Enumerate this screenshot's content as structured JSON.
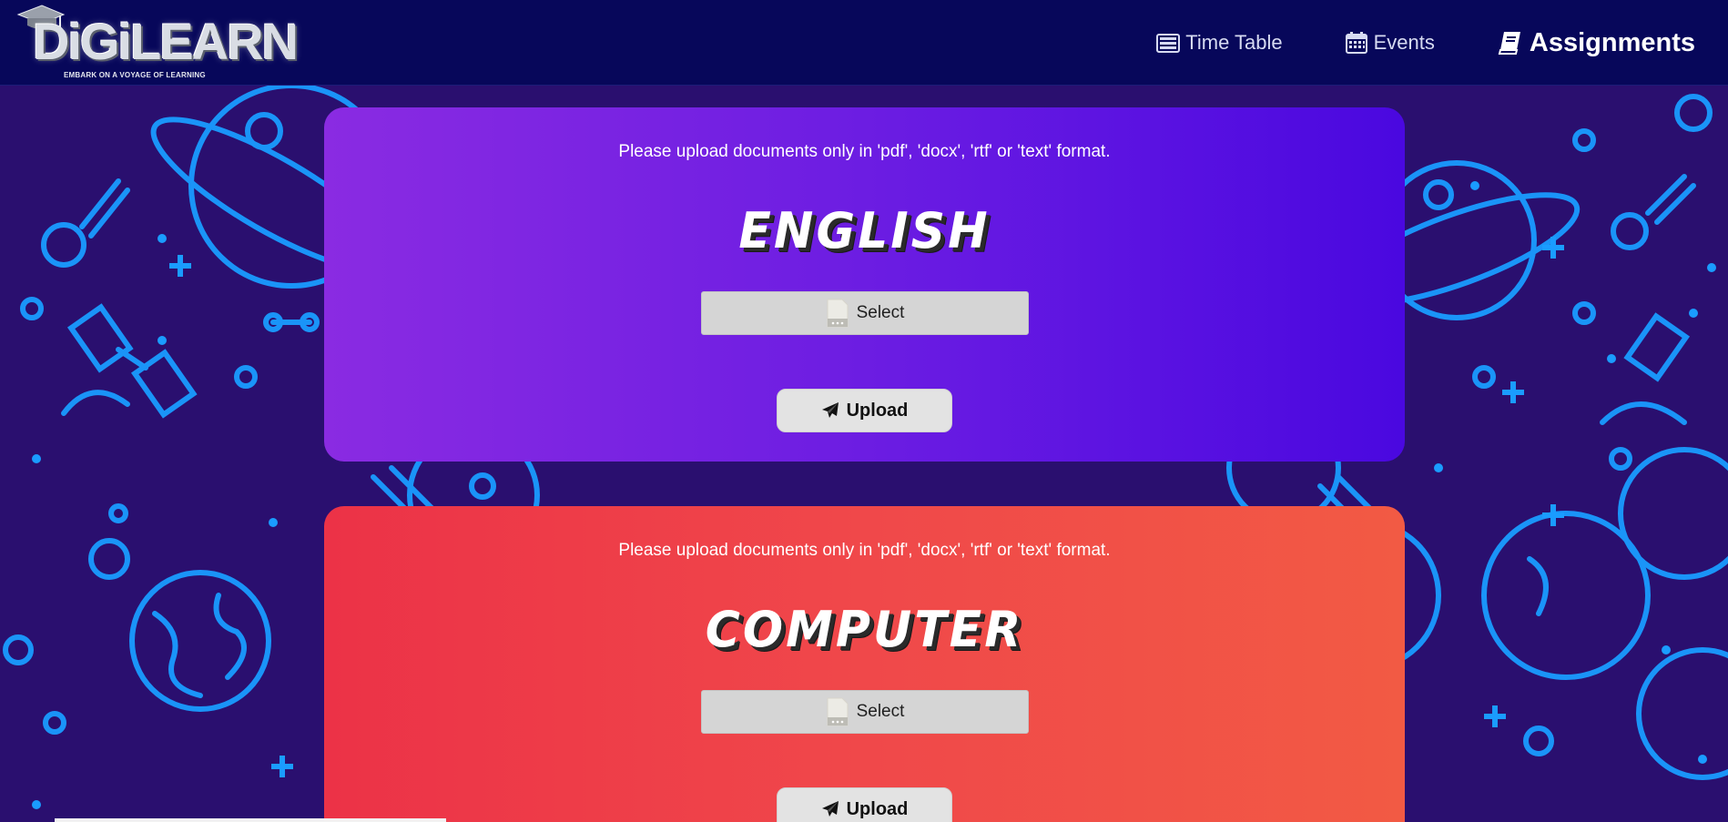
{
  "app": {
    "logo_text": "DiGiLEARN",
    "logo_tagline": "EMBARK ON A VOYAGE OF LEARNING"
  },
  "nav": {
    "items": [
      {
        "label": "Time Table",
        "icon": "timetable-icon",
        "active": false
      },
      {
        "label": "Events",
        "icon": "calendar-icon",
        "active": false
      },
      {
        "label": "Assignments",
        "icon": "book-icon",
        "active": true
      }
    ]
  },
  "cards": [
    {
      "subject": "ENGLISH",
      "note": "Please upload documents only in 'pdf', 'docx', 'rtf' or 'text' format.",
      "select_label": "Select",
      "upload_label": "Upload",
      "gradient": [
        "#8a2be2",
        "#4a08e0"
      ]
    },
    {
      "subject": "COMPUTER",
      "note": "Please upload documents only in 'pdf', 'docx', 'rtf' or 'text' format.",
      "select_label": "Select",
      "upload_label": "Upload",
      "gradient": [
        "#ec3247",
        "#f25a44"
      ]
    }
  ],
  "colors": {
    "navbar": "#07075a",
    "background": "#2a0f6f",
    "pattern": "#1a9cff"
  }
}
